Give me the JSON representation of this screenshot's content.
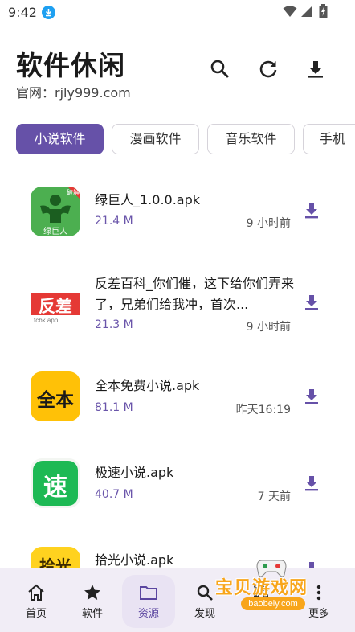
{
  "status_bar": {
    "time": "9:42",
    "icons": [
      "download-notification-icon",
      "wifi-icon",
      "signal-icon",
      "battery-charging-icon"
    ]
  },
  "header": {
    "title": "软件休闲",
    "subtitle": "官网：rjly999.com",
    "actions": [
      "search-icon",
      "refresh-icon",
      "download-icon"
    ]
  },
  "categories": {
    "selected": "小说软件",
    "items": [
      {
        "label": "小说软件"
      },
      {
        "label": "漫画软件"
      },
      {
        "label": "音乐软件"
      },
      {
        "label": "手机"
      }
    ]
  },
  "files": [
    {
      "name": "绿巨人_1.0.0.apk",
      "size": "21.4 M",
      "time": "9 小时前",
      "thumb": {
        "kind": "hulk",
        "text": "绿巨人",
        "badge": "破解",
        "bg": "#4caf50"
      }
    },
    {
      "name": "反差百科_你们催，这下给你们弄来了，兄弟们给我冲，首次...",
      "size": "21.3 M",
      "time": "9 小时前",
      "thumb": {
        "kind": "fancha",
        "text": "反差",
        "sub": "fcbk.app",
        "bg": "#e53935"
      }
    },
    {
      "name": "全本免费小说.apk",
      "size": "81.1 M",
      "time": "昨天16:19",
      "thumb": {
        "kind": "quanben",
        "text": "全本",
        "bg": "#ffc107"
      }
    },
    {
      "name": "极速小说.apk",
      "size": "40.7 M",
      "time": "7 天前",
      "thumb": {
        "kind": "jisu",
        "text": "速",
        "bg": "#1db954"
      }
    },
    {
      "name": "拾光小说.apk",
      "size": "",
      "time": "",
      "thumb": {
        "kind": "shiguang",
        "text": "拾光",
        "bg": "#ffd21f"
      }
    }
  ],
  "bottom_nav": {
    "selected": "资源",
    "items": [
      {
        "label": "首页",
        "icon": "home-icon"
      },
      {
        "label": "软件",
        "icon": "star-icon"
      },
      {
        "label": "资源",
        "icon": "folder-icon"
      },
      {
        "label": "发现",
        "icon": "search-icon"
      },
      {
        "label": "",
        "icon": "grid-icon"
      },
      {
        "label": "更多",
        "icon": "more-icon"
      }
    ]
  },
  "watermark": {
    "text": "宝贝游戏网",
    "url": "baobeiy.com"
  },
  "colors": {
    "accent": "#6651a8",
    "size_text": "#6a55aa",
    "nav_bg": "#f1edf6",
    "watermark": "#f8a51a"
  }
}
